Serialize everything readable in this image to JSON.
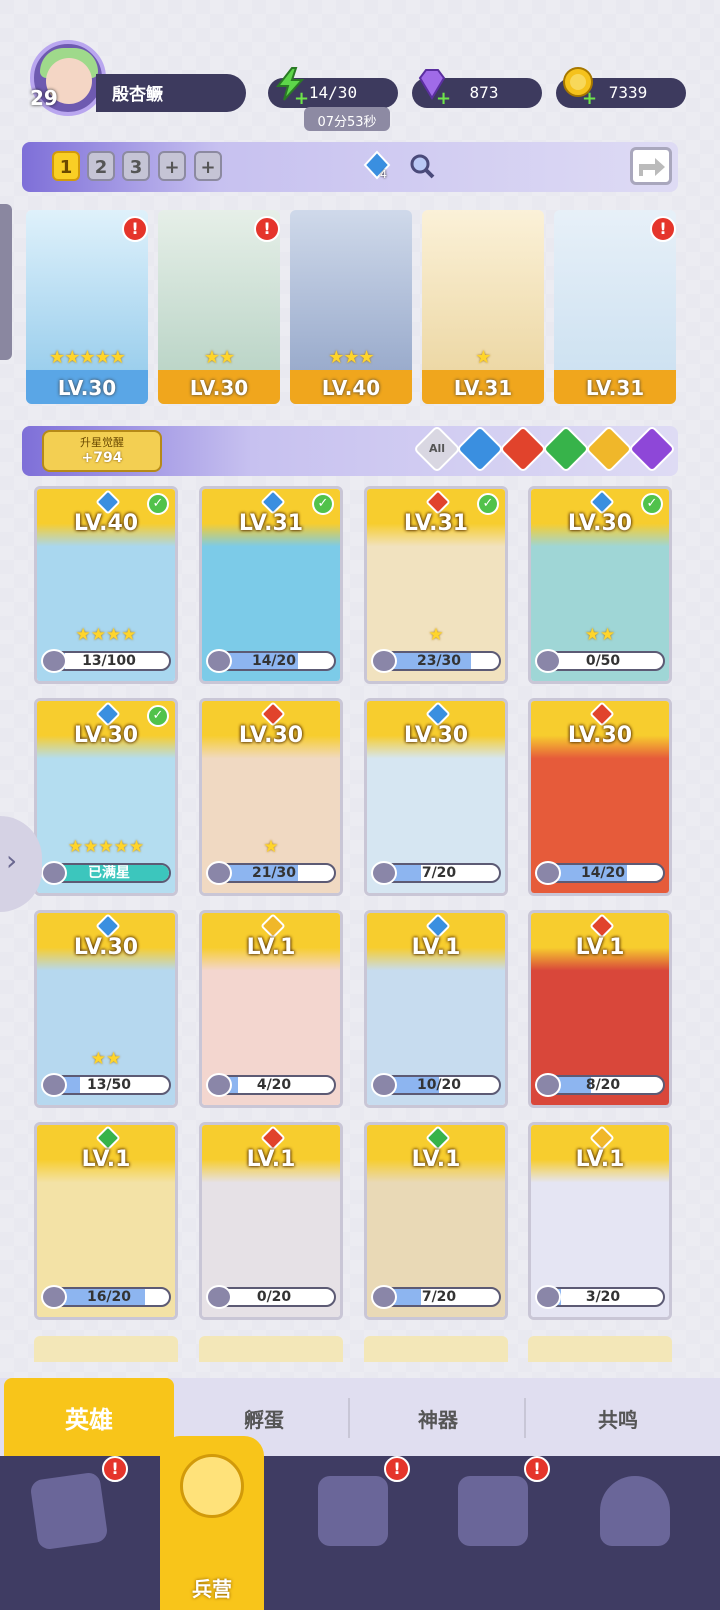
{
  "player": {
    "level": "29",
    "name": "殷杏鳜"
  },
  "resources": {
    "energy": "14/30",
    "energy_timer": "07分53秒",
    "gems": "873",
    "coins": "7339"
  },
  "team_bar": {
    "slots": [
      "1",
      "2",
      "3",
      "+",
      "+"
    ],
    "active_slot": "1",
    "bonus_count": "4"
  },
  "team": [
    {
      "level": "LV.30",
      "element": "water",
      "stars": "★★★★★",
      "alert": true
    },
    {
      "level": "LV.30",
      "element": "water",
      "stars": "★★",
      "alert": true
    },
    {
      "level": "LV.40",
      "element": "water",
      "stars": "★★★",
      "alert": false
    },
    {
      "level": "LV.31",
      "element": "fire",
      "stars": "★",
      "alert": false
    },
    {
      "level": "LV.31",
      "element": "water",
      "stars": "",
      "alert": true
    }
  ],
  "awaken": {
    "label": "升星觉醒",
    "value": "+794"
  },
  "filters": [
    {
      "label": "All",
      "color": "#d9d7e2"
    },
    {
      "label": "",
      "color": "#3a8fe0"
    },
    {
      "label": "",
      "color": "#e1432c"
    },
    {
      "label": "",
      "color": "#37b34a"
    },
    {
      "label": "",
      "color": "#f0b72a"
    },
    {
      "label": "",
      "color": "#8e47d8"
    }
  ],
  "heroes": [
    {
      "level": "LV.40",
      "element": "#3a8fe0",
      "check": true,
      "stars": "★★★★",
      "progress": "13/100",
      "pct": 0.13,
      "bg": "#a9d7ef"
    },
    {
      "level": "LV.31",
      "element": "#3a8fe0",
      "check": true,
      "stars": "",
      "progress": "14/20",
      "pct": 0.7,
      "bg": "#7ccbe8"
    },
    {
      "level": "LV.31",
      "element": "#e1432c",
      "check": true,
      "stars": "★",
      "progress": "23/30",
      "pct": 0.77,
      "bg": "#f1e2bf"
    },
    {
      "level": "LV.30",
      "element": "#3a8fe0",
      "check": true,
      "stars": "★★",
      "progress": "0/50",
      "pct": 0,
      "bg": "#9fd6d6"
    },
    {
      "level": "LV.30",
      "element": "#3a8fe0",
      "check": true,
      "stars": "★★★★★",
      "progress": "已满星",
      "pct": 1,
      "full": true,
      "bg": "#b4ddf0"
    },
    {
      "level": "LV.30",
      "element": "#e1432c",
      "check": false,
      "stars": "★",
      "progress": "21/30",
      "pct": 0.7,
      "bg": "#f0d9c2"
    },
    {
      "level": "LV.30",
      "element": "#3a8fe0",
      "check": false,
      "stars": "",
      "progress": "7/20",
      "pct": 0.35,
      "bg": "#d6e6f2"
    },
    {
      "level": "LV.30",
      "element": "#e1432c",
      "check": false,
      "stars": "",
      "progress": "14/20",
      "pct": 0.7,
      "bg": "#e65b3a"
    },
    {
      "level": "LV.30",
      "element": "#3a8fe0",
      "check": false,
      "stars": "★★",
      "progress": "13/50",
      "pct": 0.26,
      "bg": "#b6d8ef"
    },
    {
      "level": "LV.1",
      "element": "#f0b72a",
      "check": false,
      "stars": "",
      "progress": "4/20",
      "pct": 0.2,
      "bg": "#f3d6cf"
    },
    {
      "level": "LV.1",
      "element": "#3a8fe0",
      "check": false,
      "stars": "",
      "progress": "10/20",
      "pct": 0.5,
      "bg": "#c7dcef"
    },
    {
      "level": "LV.1",
      "element": "#e1432c",
      "check": false,
      "stars": "",
      "progress": "8/20",
      "pct": 0.4,
      "bg": "#d9473a"
    },
    {
      "level": "LV.1",
      "element": "#37b34a",
      "check": false,
      "stars": "",
      "progress": "16/20",
      "pct": 0.8,
      "bg": "#f3e2a6"
    },
    {
      "level": "LV.1",
      "element": "#e1432c",
      "check": false,
      "stars": "",
      "progress": "0/20",
      "pct": 0,
      "bg": "#e6e1e6"
    },
    {
      "level": "LV.1",
      "element": "#37b34a",
      "check": false,
      "stars": "",
      "progress": "7/20",
      "pct": 0.35,
      "bg": "#e9d9b6"
    },
    {
      "level": "LV.1",
      "element": "#f0b72a",
      "check": false,
      "stars": "",
      "progress": "3/20",
      "pct": 0.15,
      "bg": "#e5e5f3"
    }
  ],
  "subtabs": [
    "英雄",
    "孵蛋",
    "神器",
    "共鸣"
  ],
  "nav": {
    "active_label": "兵营"
  }
}
